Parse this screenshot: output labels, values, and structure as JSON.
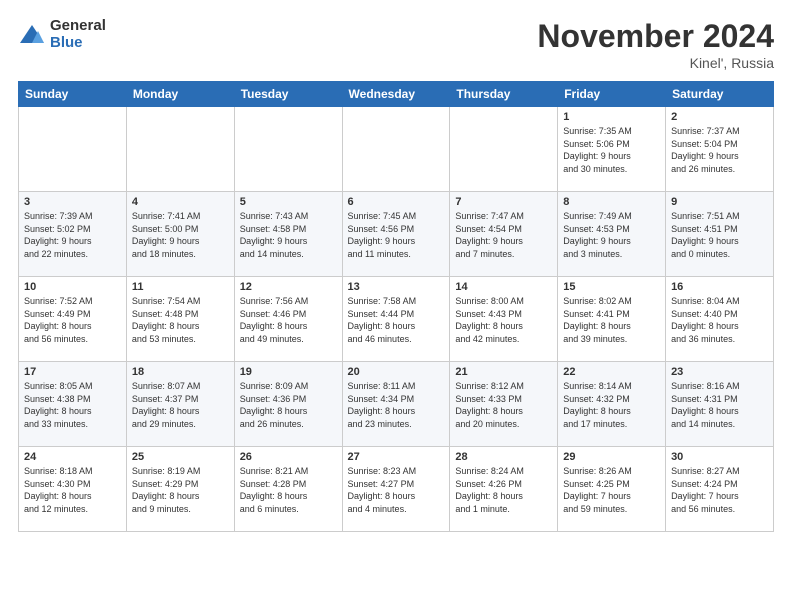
{
  "logo": {
    "general": "General",
    "blue": "Blue"
  },
  "header": {
    "title": "November 2024",
    "subtitle": "Kinel', Russia"
  },
  "days_of_week": [
    "Sunday",
    "Monday",
    "Tuesday",
    "Wednesday",
    "Thursday",
    "Friday",
    "Saturday"
  ],
  "weeks": [
    [
      {
        "day": "",
        "info": ""
      },
      {
        "day": "",
        "info": ""
      },
      {
        "day": "",
        "info": ""
      },
      {
        "day": "",
        "info": ""
      },
      {
        "day": "",
        "info": ""
      },
      {
        "day": "1",
        "info": "Sunrise: 7:35 AM\nSunset: 5:06 PM\nDaylight: 9 hours\nand 30 minutes."
      },
      {
        "day": "2",
        "info": "Sunrise: 7:37 AM\nSunset: 5:04 PM\nDaylight: 9 hours\nand 26 minutes."
      }
    ],
    [
      {
        "day": "3",
        "info": "Sunrise: 7:39 AM\nSunset: 5:02 PM\nDaylight: 9 hours\nand 22 minutes."
      },
      {
        "day": "4",
        "info": "Sunrise: 7:41 AM\nSunset: 5:00 PM\nDaylight: 9 hours\nand 18 minutes."
      },
      {
        "day": "5",
        "info": "Sunrise: 7:43 AM\nSunset: 4:58 PM\nDaylight: 9 hours\nand 14 minutes."
      },
      {
        "day": "6",
        "info": "Sunrise: 7:45 AM\nSunset: 4:56 PM\nDaylight: 9 hours\nand 11 minutes."
      },
      {
        "day": "7",
        "info": "Sunrise: 7:47 AM\nSunset: 4:54 PM\nDaylight: 9 hours\nand 7 minutes."
      },
      {
        "day": "8",
        "info": "Sunrise: 7:49 AM\nSunset: 4:53 PM\nDaylight: 9 hours\nand 3 minutes."
      },
      {
        "day": "9",
        "info": "Sunrise: 7:51 AM\nSunset: 4:51 PM\nDaylight: 9 hours\nand 0 minutes."
      }
    ],
    [
      {
        "day": "10",
        "info": "Sunrise: 7:52 AM\nSunset: 4:49 PM\nDaylight: 8 hours\nand 56 minutes."
      },
      {
        "day": "11",
        "info": "Sunrise: 7:54 AM\nSunset: 4:48 PM\nDaylight: 8 hours\nand 53 minutes."
      },
      {
        "day": "12",
        "info": "Sunrise: 7:56 AM\nSunset: 4:46 PM\nDaylight: 8 hours\nand 49 minutes."
      },
      {
        "day": "13",
        "info": "Sunrise: 7:58 AM\nSunset: 4:44 PM\nDaylight: 8 hours\nand 46 minutes."
      },
      {
        "day": "14",
        "info": "Sunrise: 8:00 AM\nSunset: 4:43 PM\nDaylight: 8 hours\nand 42 minutes."
      },
      {
        "day": "15",
        "info": "Sunrise: 8:02 AM\nSunset: 4:41 PM\nDaylight: 8 hours\nand 39 minutes."
      },
      {
        "day": "16",
        "info": "Sunrise: 8:04 AM\nSunset: 4:40 PM\nDaylight: 8 hours\nand 36 minutes."
      }
    ],
    [
      {
        "day": "17",
        "info": "Sunrise: 8:05 AM\nSunset: 4:38 PM\nDaylight: 8 hours\nand 33 minutes."
      },
      {
        "day": "18",
        "info": "Sunrise: 8:07 AM\nSunset: 4:37 PM\nDaylight: 8 hours\nand 29 minutes."
      },
      {
        "day": "19",
        "info": "Sunrise: 8:09 AM\nSunset: 4:36 PM\nDaylight: 8 hours\nand 26 minutes."
      },
      {
        "day": "20",
        "info": "Sunrise: 8:11 AM\nSunset: 4:34 PM\nDaylight: 8 hours\nand 23 minutes."
      },
      {
        "day": "21",
        "info": "Sunrise: 8:12 AM\nSunset: 4:33 PM\nDaylight: 8 hours\nand 20 minutes."
      },
      {
        "day": "22",
        "info": "Sunrise: 8:14 AM\nSunset: 4:32 PM\nDaylight: 8 hours\nand 17 minutes."
      },
      {
        "day": "23",
        "info": "Sunrise: 8:16 AM\nSunset: 4:31 PM\nDaylight: 8 hours\nand 14 minutes."
      }
    ],
    [
      {
        "day": "24",
        "info": "Sunrise: 8:18 AM\nSunset: 4:30 PM\nDaylight: 8 hours\nand 12 minutes."
      },
      {
        "day": "25",
        "info": "Sunrise: 8:19 AM\nSunset: 4:29 PM\nDaylight: 8 hours\nand 9 minutes."
      },
      {
        "day": "26",
        "info": "Sunrise: 8:21 AM\nSunset: 4:28 PM\nDaylight: 8 hours\nand 6 minutes."
      },
      {
        "day": "27",
        "info": "Sunrise: 8:23 AM\nSunset: 4:27 PM\nDaylight: 8 hours\nand 4 minutes."
      },
      {
        "day": "28",
        "info": "Sunrise: 8:24 AM\nSunset: 4:26 PM\nDaylight: 8 hours\nand 1 minute."
      },
      {
        "day": "29",
        "info": "Sunrise: 8:26 AM\nSunset: 4:25 PM\nDaylight: 7 hours\nand 59 minutes."
      },
      {
        "day": "30",
        "info": "Sunrise: 8:27 AM\nSunset: 4:24 PM\nDaylight: 7 hours\nand 56 minutes."
      }
    ]
  ]
}
